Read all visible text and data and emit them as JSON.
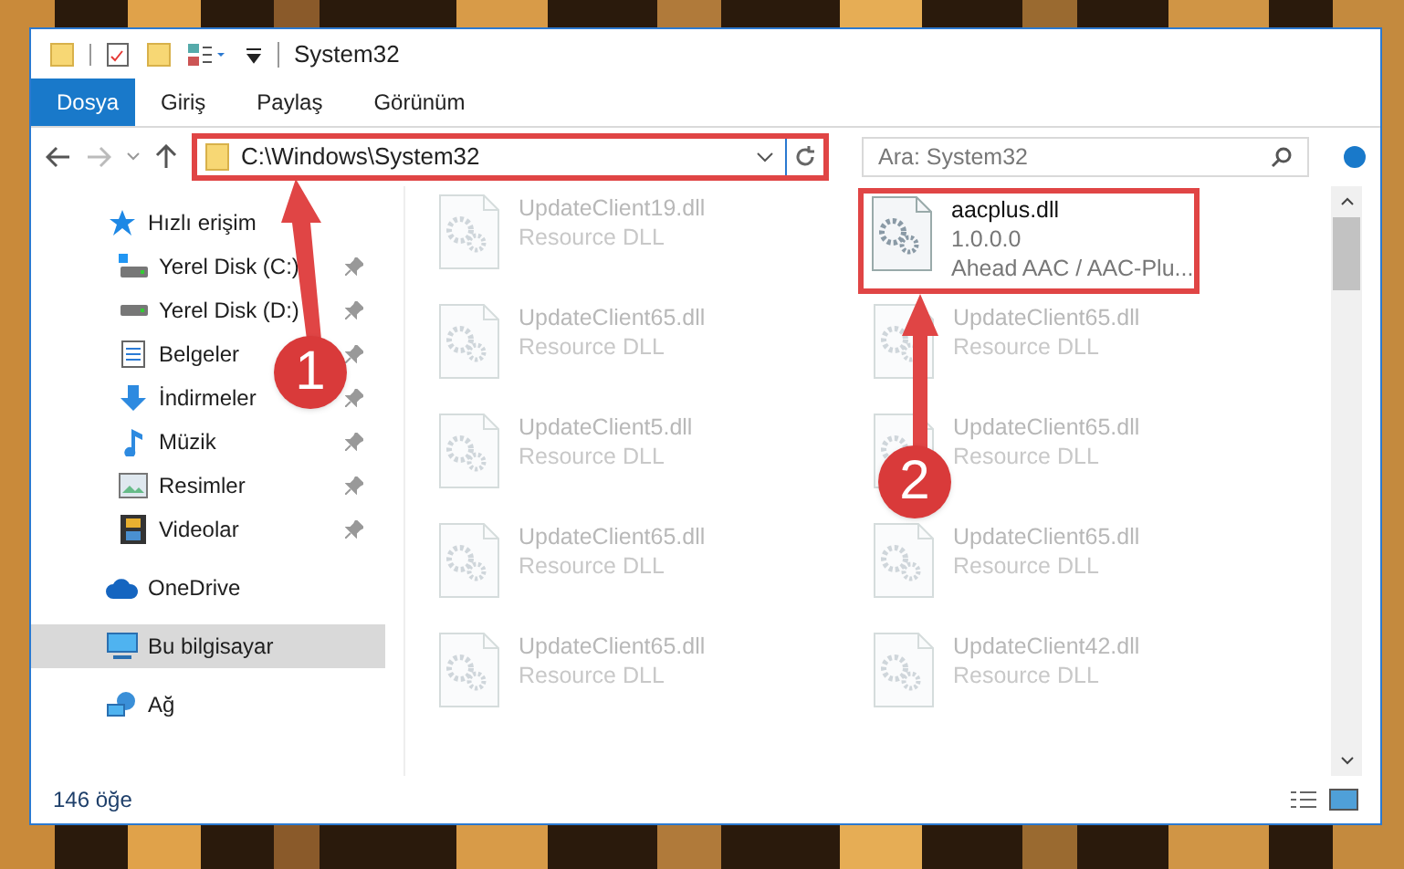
{
  "window": {
    "title": "System32"
  },
  "ribbon_tabs": [
    {
      "label": "Dosya",
      "selected": true
    },
    {
      "label": "Giriş",
      "selected": false
    },
    {
      "label": "Paylaş",
      "selected": false
    },
    {
      "label": "Görünüm",
      "selected": false
    }
  ],
  "address_bar": {
    "path": "C:\\Windows\\System32"
  },
  "search": {
    "placeholder": "Ara: System32"
  },
  "sidebar": {
    "items": [
      {
        "label": "Hızlı erişim",
        "kind": "star",
        "selected": false,
        "pinned": false,
        "children": [
          {
            "label": "Yerel Disk (C:)",
            "kind": "drivec",
            "selected": false,
            "pinned": true
          },
          {
            "label": "Yerel Disk (D:)",
            "kind": "drive",
            "selected": false,
            "pinned": true
          },
          {
            "label": "Belgeler",
            "kind": "doc",
            "selected": false,
            "pinned": true
          },
          {
            "label": "İndirmeler",
            "kind": "download",
            "selected": false,
            "pinned": true
          },
          {
            "label": "Müzik",
            "kind": "music",
            "selected": false,
            "pinned": true
          },
          {
            "label": "Resimler",
            "kind": "pictures",
            "selected": false,
            "pinned": true
          },
          {
            "label": "Videolar",
            "kind": "video",
            "selected": false,
            "pinned": true
          }
        ]
      },
      {
        "label": "OneDrive",
        "kind": "cloud",
        "selected": false,
        "pinned": false
      },
      {
        "label": "Bu bilgisayar",
        "kind": "pc",
        "selected": true,
        "pinned": false
      },
      {
        "label": "Ağ",
        "kind": "network",
        "selected": false,
        "pinned": false
      }
    ]
  },
  "files": [
    {
      "name": "UpdateClient19.dll",
      "lines": [
        "Resource DLL"
      ],
      "highlighted": false
    },
    {
      "name": "aacplus.dll",
      "lines": [
        "1.0.0.0",
        "Ahead AAC / AAC-Plu..."
      ],
      "highlighted": true
    },
    {
      "name": "UpdateClient65.dll",
      "lines": [
        "Resource DLL"
      ],
      "highlighted": false
    },
    {
      "name": "UpdateClient65.dll",
      "lines": [
        "Resource DLL"
      ],
      "highlighted": false
    },
    {
      "name": "UpdateClient5.dll",
      "lines": [
        "Resource DLL"
      ],
      "highlighted": false
    },
    {
      "name": "UpdateClient65.dll",
      "lines": [
        "Resource DLL"
      ],
      "highlighted": false
    },
    {
      "name": "UpdateClient65.dll",
      "lines": [
        "Resource DLL"
      ],
      "highlighted": false
    },
    {
      "name": "UpdateClient65.dll",
      "lines": [
        "Resource DLL"
      ],
      "highlighted": false
    },
    {
      "name": "UpdateClient65.dll",
      "lines": [
        "Resource DLL"
      ],
      "highlighted": false
    },
    {
      "name": "UpdateClient42.dll",
      "lines": [
        "Resource DLL"
      ],
      "highlighted": false
    }
  ],
  "status_bar": {
    "item_count": "146 öğe"
  },
  "annotations": [
    {
      "number": "1"
    },
    {
      "number": "2"
    }
  ]
}
